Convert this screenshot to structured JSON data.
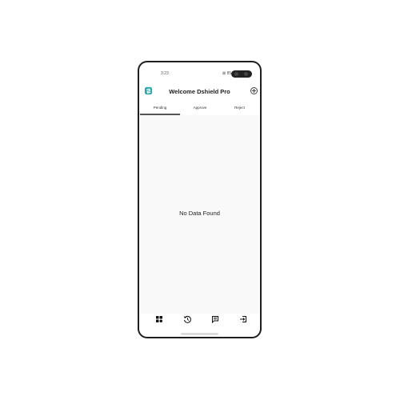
{
  "status_bar": {
    "time": "3:23",
    "indicators": "⊠ 85"
  },
  "header": {
    "title": "Welcome Dshield Pro",
    "logo_icon": "dshield-logo-icon",
    "action_icon": "add-circle-icon"
  },
  "tabs": [
    {
      "label": "Pending",
      "selected": true
    },
    {
      "label": "Approve",
      "selected": false
    },
    {
      "label": "Reject",
      "selected": false
    }
  ],
  "content": {
    "empty_message": "No Data Found"
  },
  "bottom_nav": [
    {
      "icon": "dashboard-grid-icon"
    },
    {
      "icon": "history-icon"
    },
    {
      "icon": "messages-icon"
    },
    {
      "icon": "logout-icon"
    }
  ],
  "colors": {
    "accent": "#2aa8b0",
    "text": "#222222",
    "phone_frame": "#1e1e1e"
  }
}
